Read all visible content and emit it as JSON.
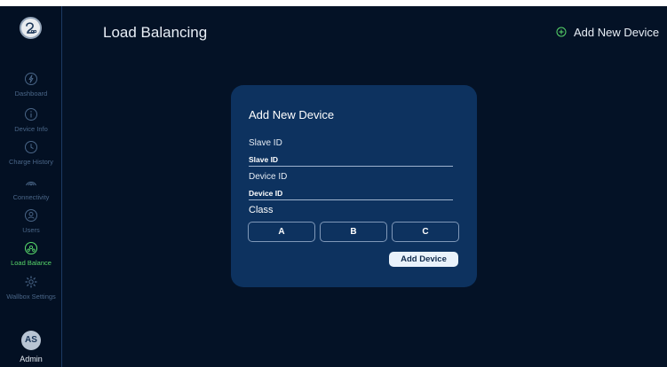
{
  "header": {
    "title": "Load Balancing",
    "add_label": "Add New Device",
    "add_icon": "plus-circle-icon",
    "accent": "#57d66a"
  },
  "sidebar": {
    "logo_icon": "brand-logo-icon",
    "items": [
      {
        "label": "Dashboard",
        "icon": "lightning-circle-icon",
        "active": false
      },
      {
        "label": "Device Info",
        "icon": "info-circle-icon",
        "active": false
      },
      {
        "label": "Charge History",
        "icon": "clock-icon",
        "active": false
      },
      {
        "label": "Connectivity",
        "icon": "signal-icon",
        "active": false
      },
      {
        "label": "Users",
        "icon": "user-icon",
        "active": false
      },
      {
        "label": "Load Balance",
        "icon": "balance-icon",
        "active": true
      },
      {
        "label": "Wallbox Settings",
        "icon": "gear-icon",
        "active": false
      }
    ],
    "user": {
      "initials": "AS",
      "name": "Admin"
    }
  },
  "modal": {
    "title": "Add New Device",
    "slave_id_label": "Slave ID",
    "slave_id_placeholder": "Slave ID",
    "device_id_label": "Device ID",
    "device_id_placeholder": "Device ID",
    "class_label": "Class",
    "class_options": [
      "A",
      "B",
      "C"
    ],
    "submit_label": "Add Device"
  },
  "colors": {
    "background": "#041226",
    "modal": "#0d325f",
    "active": "#57d66a",
    "inactive": "#4a6688"
  }
}
